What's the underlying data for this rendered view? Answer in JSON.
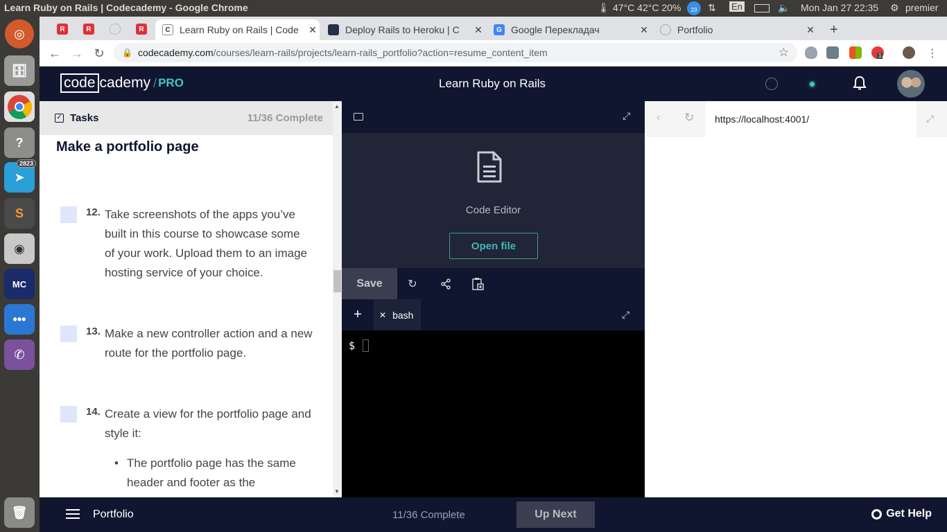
{
  "os": {
    "window_title": "Learn Ruby on Rails | Codecademy - Google Chrome",
    "weather": "47°C 42°C 20%",
    "keyboard_layout": "En",
    "clock": "Mon Jan 27 22:35",
    "username": "premier",
    "launcher_badge": "2823",
    "notif_badge": "23"
  },
  "chrome": {
    "tabs": [
      {
        "label": "Learn Ruby on Rails | Code",
        "fav": "C",
        "fav_color": "#ffffff"
      },
      {
        "label": "Deploy Rails to Heroku | C",
        "fav": "",
        "fav_color": "#253047"
      },
      {
        "label": "Google Перекладач",
        "fav": "G",
        "fav_color": "#4285f4"
      },
      {
        "label": "Portfolio",
        "fav": "",
        "fav_color": "#bbbbbb"
      }
    ],
    "url_host": "codecademy.com",
    "url_path": "/courses/learn-rails/projects/learn-rails_portfolio?action=resume_content_item",
    "ext_badge": "1"
  },
  "header": {
    "logo_code": "code",
    "logo_cademy": "cademy",
    "logo_pro": "PRO",
    "course_title": "Learn Ruby on Rails"
  },
  "tasks": {
    "label": "Tasks",
    "count": "11/36 Complete",
    "section_title": "Make a portfolio page",
    "items": [
      {
        "num": "12.",
        "text": "Take screenshots of the apps you’ve built in this course to showcase some of your work. Upload them to an image hosting service of your choice."
      },
      {
        "num": "13.",
        "text": "Make a new controller action and a new route for the portfolio page."
      },
      {
        "num": "14.",
        "text": "Create a view for the portfolio page and style it:"
      }
    ],
    "bullet": "The portfolio page has the same header and footer as the"
  },
  "editor": {
    "label": "Code Editor",
    "open_file": "Open file",
    "save": "Save"
  },
  "terminal": {
    "tab": "bash",
    "prompt": "$"
  },
  "preview": {
    "url": "https://localhost:4001/"
  },
  "footer": {
    "title": "Portfolio",
    "progress": "11/36 Complete",
    "up_next": "Up Next",
    "get_help": "Get Help"
  }
}
